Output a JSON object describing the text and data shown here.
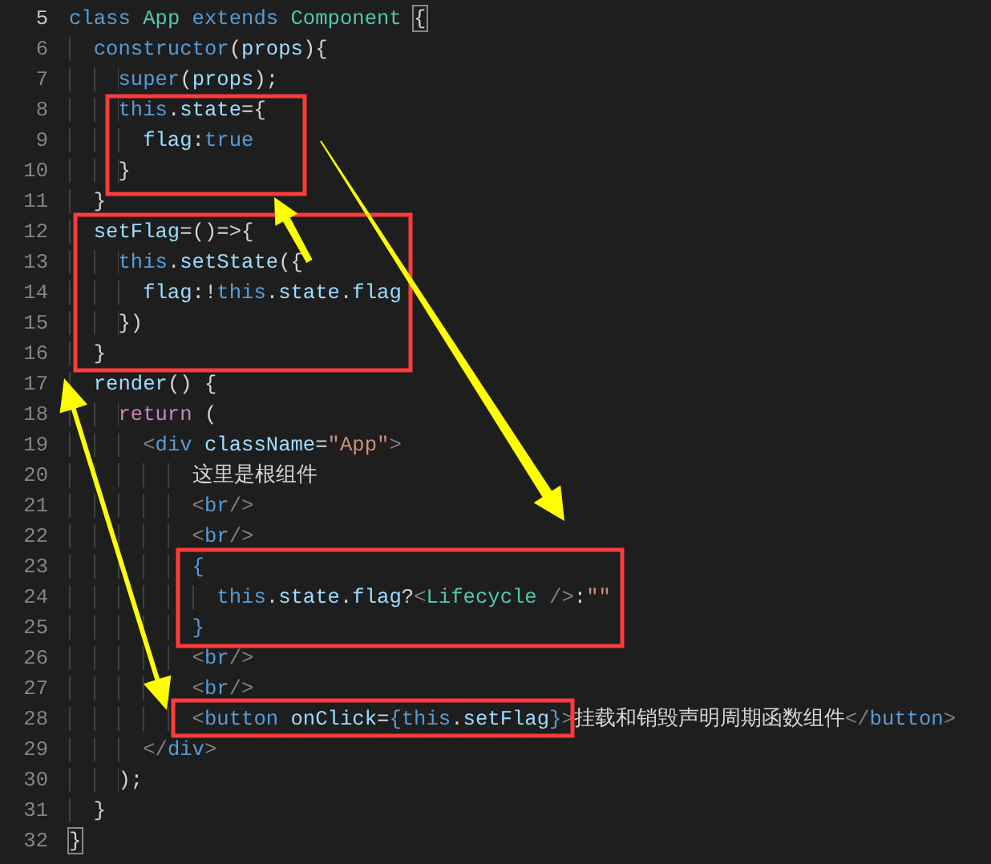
{
  "editor": {
    "lines": [
      {
        "number": "5",
        "tokens": [
          {
            "text": "class",
            "kind": "keyword"
          },
          {
            "text": " App",
            "kind": "type"
          },
          {
            "text": " extends",
            "kind": "keyword"
          },
          {
            "text": " Component ",
            "kind": "type"
          },
          {
            "text": "{",
            "kind": "matched"
          }
        ]
      },
      {
        "number": "6",
        "tokens": [
          {
            "text": "  constructor",
            "kind": "keyword"
          },
          {
            "text": "(",
            "kind": "plain"
          },
          {
            "text": "props",
            "kind": "variable"
          },
          {
            "text": "){",
            "kind": "plain"
          }
        ]
      },
      {
        "number": "7",
        "tokens": [
          {
            "text": "    super",
            "kind": "keyword"
          },
          {
            "text": "(",
            "kind": "plain"
          },
          {
            "text": "props",
            "kind": "variable"
          },
          {
            "text": ");",
            "kind": "plain"
          }
        ]
      },
      {
        "number": "8",
        "tokens": [
          {
            "text": "    this",
            "kind": "keyword"
          },
          {
            "text": ".",
            "kind": "plain"
          },
          {
            "text": "state",
            "kind": "variable"
          },
          {
            "text": "={",
            "kind": "plain"
          }
        ]
      },
      {
        "number": "9",
        "tokens": [
          {
            "text": "      flag",
            "kind": "variable"
          },
          {
            "text": ":",
            "kind": "plain"
          },
          {
            "text": "true",
            "kind": "keyword"
          }
        ]
      },
      {
        "number": "10",
        "tokens": [
          {
            "text": "    }",
            "kind": "plain"
          }
        ]
      },
      {
        "number": "11",
        "tokens": [
          {
            "text": "  }",
            "kind": "plain"
          }
        ]
      },
      {
        "number": "12",
        "tokens": [
          {
            "text": "  setFlag",
            "kind": "variable"
          },
          {
            "text": "=()=>{",
            "kind": "plain"
          }
        ]
      },
      {
        "number": "13",
        "tokens": [
          {
            "text": "    this",
            "kind": "keyword"
          },
          {
            "text": ".",
            "kind": "plain"
          },
          {
            "text": "setState",
            "kind": "variable"
          },
          {
            "text": "({",
            "kind": "plain"
          }
        ]
      },
      {
        "number": "14",
        "tokens": [
          {
            "text": "      flag",
            "kind": "variable"
          },
          {
            "text": ":!",
            "kind": "plain"
          },
          {
            "text": "this",
            "kind": "keyword"
          },
          {
            "text": ".",
            "kind": "plain"
          },
          {
            "text": "state",
            "kind": "variable"
          },
          {
            "text": ".",
            "kind": "plain"
          },
          {
            "text": "flag",
            "kind": "variable"
          }
        ]
      },
      {
        "number": "15",
        "tokens": [
          {
            "text": "    })",
            "kind": "plain"
          }
        ]
      },
      {
        "number": "16",
        "tokens": [
          {
            "text": "  }",
            "kind": "plain"
          }
        ]
      },
      {
        "number": "17",
        "tokens": [
          {
            "text": "  render",
            "kind": "variable"
          },
          {
            "text": "() {",
            "kind": "plain"
          }
        ]
      },
      {
        "number": "18",
        "tokens": [
          {
            "text": "    return",
            "kind": "control"
          },
          {
            "text": " (",
            "kind": "plain"
          }
        ]
      },
      {
        "number": "19",
        "tokens": [
          {
            "text": "      <",
            "kind": "tag"
          },
          {
            "text": "div",
            "kind": "keyword"
          },
          {
            "text": " className",
            "kind": "variable"
          },
          {
            "text": "=",
            "kind": "plain"
          },
          {
            "text": "\"App\"",
            "kind": "string"
          },
          {
            "text": ">",
            "kind": "tag"
          }
        ]
      },
      {
        "number": "20",
        "tokens": [
          {
            "text": "          这里是根组件",
            "kind": "plain"
          }
        ]
      },
      {
        "number": "21",
        "tokens": [
          {
            "text": "          <",
            "kind": "tag"
          },
          {
            "text": "br",
            "kind": "keyword"
          },
          {
            "text": "/>",
            "kind": "tag"
          }
        ]
      },
      {
        "number": "22",
        "tokens": [
          {
            "text": "          <",
            "kind": "tag"
          },
          {
            "text": "br",
            "kind": "keyword"
          },
          {
            "text": "/>",
            "kind": "tag"
          }
        ]
      },
      {
        "number": "23",
        "tokens": [
          {
            "text": "          {",
            "kind": "keyword"
          }
        ]
      },
      {
        "number": "24",
        "tokens": [
          {
            "text": "            this",
            "kind": "keyword"
          },
          {
            "text": ".",
            "kind": "plain"
          },
          {
            "text": "state",
            "kind": "variable"
          },
          {
            "text": ".",
            "kind": "plain"
          },
          {
            "text": "flag",
            "kind": "variable"
          },
          {
            "text": "?",
            "kind": "plain"
          },
          {
            "text": "<",
            "kind": "tag"
          },
          {
            "text": "Lifecycle",
            "kind": "type"
          },
          {
            "text": " />",
            "kind": "tag"
          },
          {
            "text": ":",
            "kind": "plain"
          },
          {
            "text": "\"\"",
            "kind": "string"
          }
        ]
      },
      {
        "number": "25",
        "tokens": [
          {
            "text": "          }",
            "kind": "keyword"
          }
        ]
      },
      {
        "number": "26",
        "tokens": [
          {
            "text": "          <",
            "kind": "tag"
          },
          {
            "text": "br",
            "kind": "keyword"
          },
          {
            "text": "/>",
            "kind": "tag"
          }
        ]
      },
      {
        "number": "27",
        "tokens": [
          {
            "text": "          <",
            "kind": "tag"
          },
          {
            "text": "br",
            "kind": "keyword"
          },
          {
            "text": "/>",
            "kind": "tag"
          }
        ]
      },
      {
        "number": "28",
        "tokens": [
          {
            "text": "          <",
            "kind": "tag"
          },
          {
            "text": "button",
            "kind": "keyword"
          },
          {
            "text": " onClick",
            "kind": "variable"
          },
          {
            "text": "=",
            "kind": "plain"
          },
          {
            "text": "{",
            "kind": "keyword"
          },
          {
            "text": "this",
            "kind": "keyword"
          },
          {
            "text": ".",
            "kind": "plain"
          },
          {
            "text": "setFlag",
            "kind": "variable"
          },
          {
            "text": "}",
            "kind": "keyword"
          },
          {
            "text": ">",
            "kind": "tag"
          },
          {
            "text": "挂载和销毁声明周期函数组件",
            "kind": "plain"
          },
          {
            "text": "</",
            "kind": "tag"
          },
          {
            "text": "button",
            "kind": "keyword"
          },
          {
            "text": ">",
            "kind": "tag"
          }
        ]
      },
      {
        "number": "29",
        "tokens": [
          {
            "text": "      </",
            "kind": "tag"
          },
          {
            "text": "div",
            "kind": "keyword"
          },
          {
            "text": ">",
            "kind": "tag"
          }
        ]
      },
      {
        "number": "30",
        "tokens": [
          {
            "text": "    );",
            "kind": "plain"
          }
        ]
      },
      {
        "number": "31",
        "tokens": [
          {
            "text": "  }",
            "kind": "plain"
          }
        ]
      },
      {
        "number": "32",
        "tokens": [
          {
            "text": "}",
            "kind": "matched"
          }
        ]
      }
    ]
  }
}
